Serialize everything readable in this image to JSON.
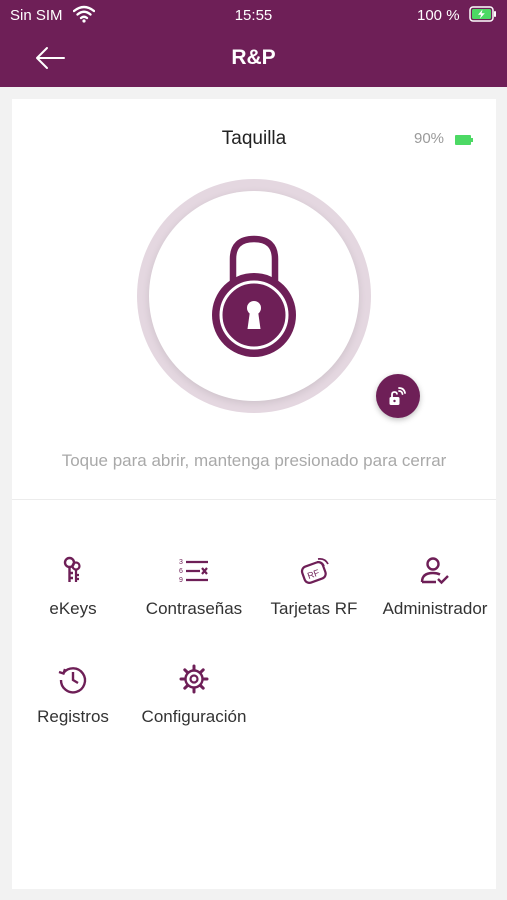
{
  "status_bar": {
    "carrier": "Sin SIM",
    "time": "15:55",
    "battery": "100 %",
    "icons": [
      "wifi-icon",
      "battery-charging-icon"
    ]
  },
  "header": {
    "title": "R&P",
    "back_icon": "arrow-left-icon"
  },
  "lock": {
    "name": "Taquilla",
    "battery": "90%",
    "battery_level": 0.9,
    "hint": "Toque para abrir, mantenga presionado para cerrar",
    "icons": [
      "padlock-icon",
      "remote-unlock-icon"
    ]
  },
  "menu": [
    {
      "label": "eKeys",
      "icon": "ekeys-icon"
    },
    {
      "label": "Contraseñas",
      "icon": "passcodes-icon"
    },
    {
      "label": "Tarjetas RF",
      "icon": "rf-card-icon"
    },
    {
      "label": "Administrador",
      "icon": "admin-user-icon"
    },
    {
      "label": "Registros",
      "icon": "history-icon"
    },
    {
      "label": "Configuración",
      "icon": "settings-gear-icon"
    }
  ],
  "colors": {
    "brand": "#6e1f57",
    "ring": "#e4d7e0",
    "battery_green": "#4cd964",
    "hint_text": "#a9a9a9"
  }
}
